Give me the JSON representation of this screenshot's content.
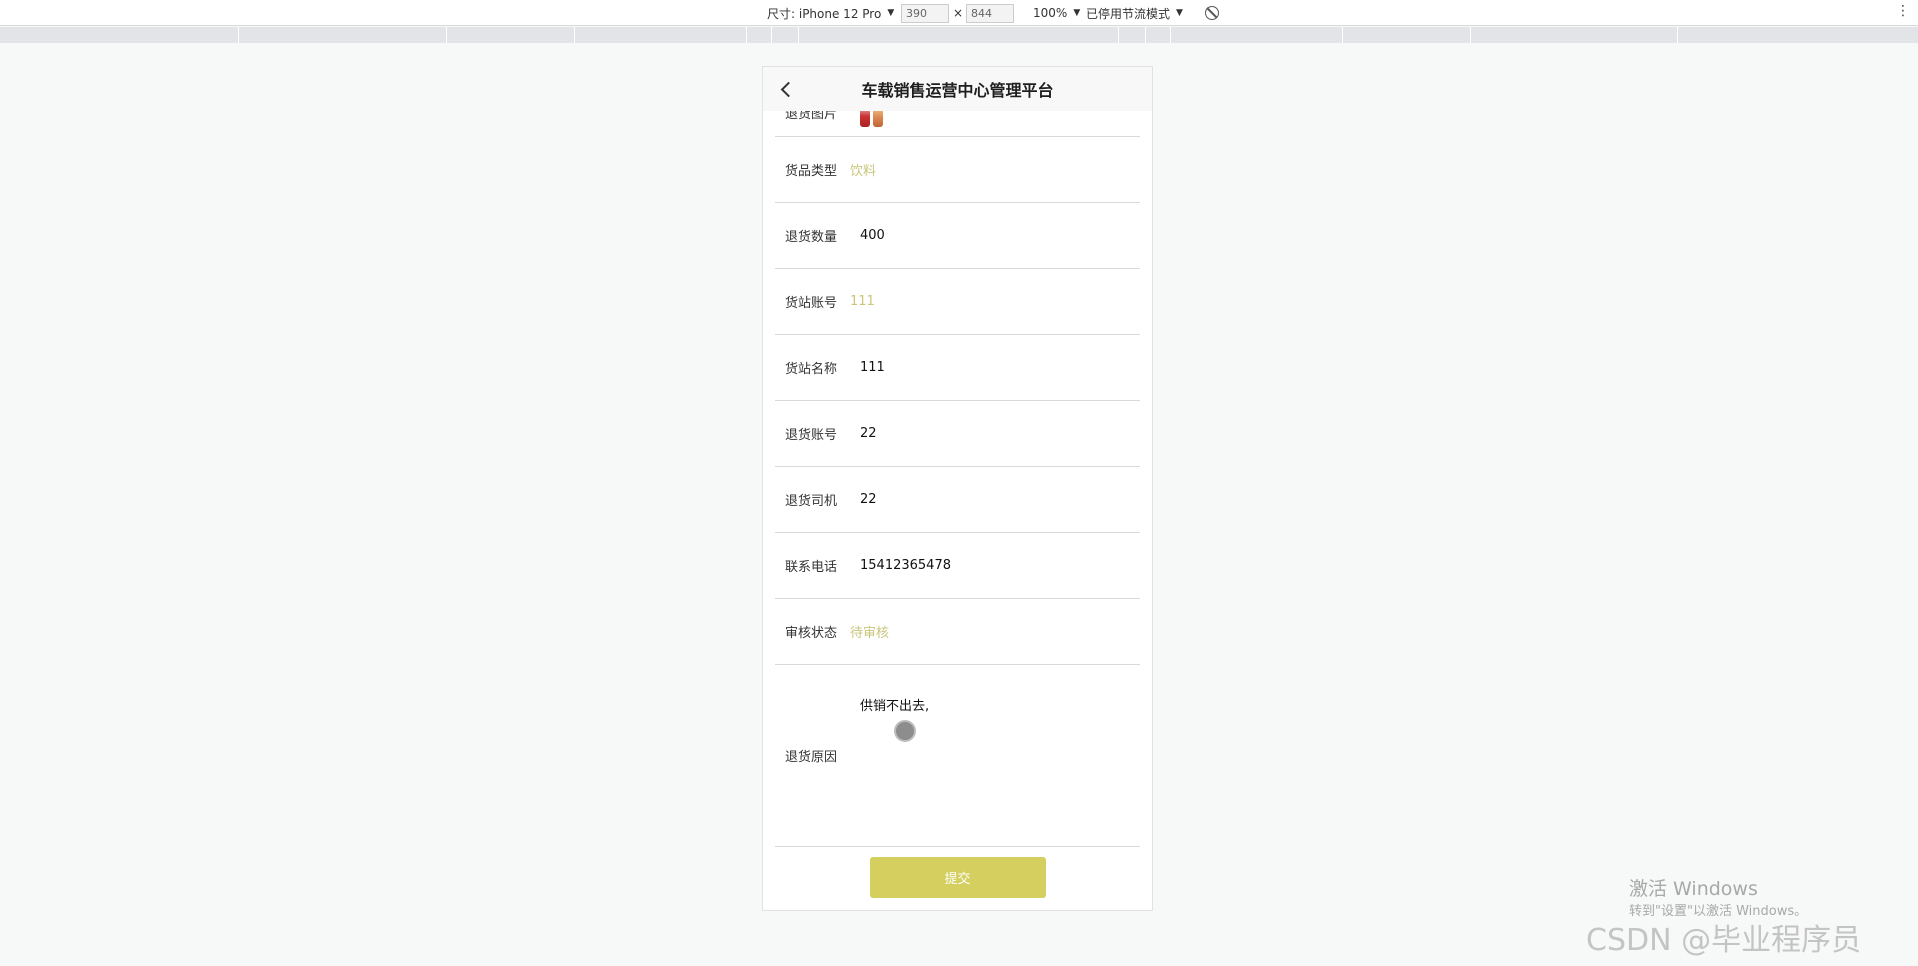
{
  "devtools": {
    "device_label": "尺寸: iPhone 12 Pro",
    "width": "390",
    "times": "×",
    "height": "844",
    "zoom": "100%",
    "throttle": "已停用节流模式"
  },
  "header": {
    "title": "车载销售运营中心管理平台"
  },
  "form": {
    "partial_label": "退货图片",
    "fields": [
      {
        "label": "货品类型",
        "value": "饮料"
      },
      {
        "label": "退货数量",
        "value": "400"
      },
      {
        "label": "货站账号",
        "value": "111"
      },
      {
        "label": "货站名称",
        "value": "111"
      },
      {
        "label": "退货账号",
        "value": "22"
      },
      {
        "label": "退货司机",
        "value": "22"
      },
      {
        "label": "联系电话",
        "value": "15412365478"
      },
      {
        "label": "审核状态",
        "value": "待审核"
      }
    ],
    "reason": {
      "label": "退货原因",
      "value": "供销不出去,"
    },
    "submit_label": "提交"
  },
  "watermark": {
    "line1": "激活 Windows",
    "line2": "转到\"设置\"以激活 Windows。",
    "csdn": "CSDN @毕业程序员"
  }
}
